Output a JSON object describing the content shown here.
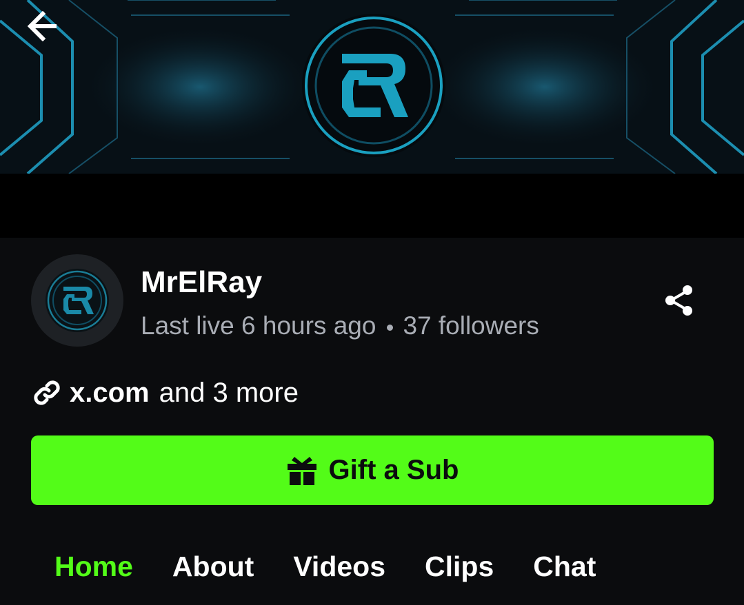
{
  "header": {
    "back_icon": "arrow-left-icon"
  },
  "banner": {
    "logo_icon": "er-logo",
    "accent_color": "#1aa0c0"
  },
  "channel": {
    "name": "MrElRay",
    "last_live": "Last live 6 hours ago",
    "followers": "37 followers"
  },
  "links": {
    "icon": "link-icon",
    "domain": "x.com",
    "more": "and 3 more"
  },
  "gift_button": {
    "label": "Gift a Sub",
    "icon": "gift-icon",
    "color": "#53fc18"
  },
  "tabs": [
    {
      "label": "Home",
      "active": true
    },
    {
      "label": "About",
      "active": false
    },
    {
      "label": "Videos",
      "active": false
    },
    {
      "label": "Clips",
      "active": false
    },
    {
      "label": "Chat",
      "active": false
    }
  ]
}
